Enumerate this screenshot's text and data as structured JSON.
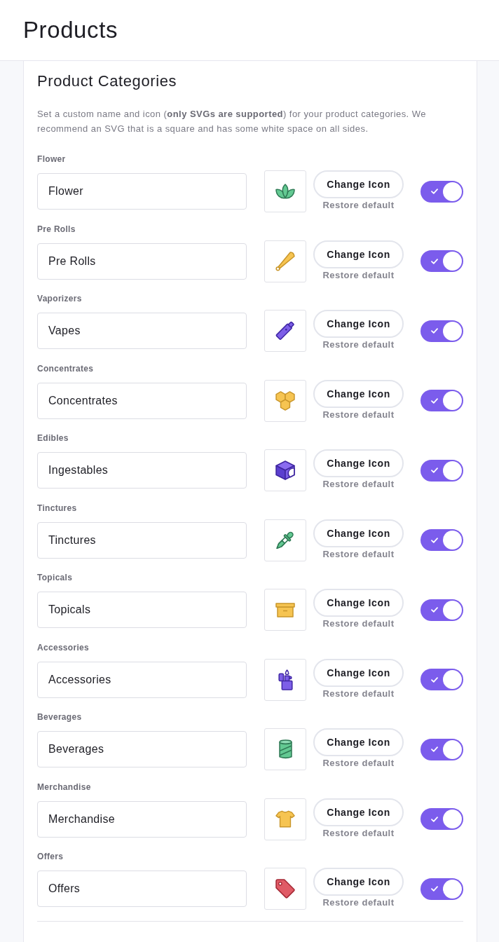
{
  "header": {
    "title": "Products"
  },
  "section": {
    "title": "Product Categories",
    "description": "Set a custom name and icon (**only SVGs are supported**) for your product categories. We recommend an SVG that is a square and has some white space on all sides."
  },
  "categories": [
    {
      "label": "Flower",
      "name": "Flower",
      "change_button": "Change Icon",
      "restore_link": "Restore default",
      "enabled": true
    },
    {
      "label": "Pre Rolls",
      "name": "Pre Rolls",
      "change_button": "Change Icon",
      "restore_link": "Restore default",
      "enabled": true
    },
    {
      "label": "Vaporizers",
      "name": "Vapes",
      "change_button": "Change Icon",
      "restore_link": "Restore default",
      "enabled": true
    },
    {
      "label": "Concentrates",
      "name": "Concentrates",
      "change_button": "Change Icon",
      "restore_link": "Restore default",
      "enabled": true
    },
    {
      "label": "Edibles",
      "name": "Ingestables",
      "change_button": "Change Icon",
      "restore_link": "Restore default",
      "enabled": true
    },
    {
      "label": "Tinctures",
      "name": "Tinctures",
      "change_button": "Change Icon",
      "restore_link": "Restore default",
      "enabled": true
    },
    {
      "label": "Topicals",
      "name": "Topicals",
      "change_button": "Change Icon",
      "restore_link": "Restore default",
      "enabled": true
    },
    {
      "label": "Accessories",
      "name": "Accessories",
      "change_button": "Change Icon",
      "restore_link": "Restore default",
      "enabled": true
    },
    {
      "label": "Beverages",
      "name": "Beverages",
      "change_button": "Change Icon",
      "restore_link": "Restore default",
      "enabled": true
    },
    {
      "label": "Merchandise",
      "name": "Merchandise",
      "change_button": "Change Icon",
      "restore_link": "Restore default",
      "enabled": true
    },
    {
      "label": "Offers",
      "name": "Offers",
      "change_button": "Change Icon",
      "restore_link": "Restore default",
      "enabled": true
    }
  ]
}
